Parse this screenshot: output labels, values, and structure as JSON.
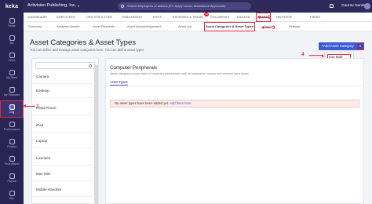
{
  "brand": "keka",
  "topbar": {
    "company": "Activision Publishing, Inc.",
    "search_placeholder": "Search employees or actions (Ex: Apply Leave, Attendance Approvals)",
    "user": "Gaurav Nandan"
  },
  "rail": [
    {
      "label": "Home"
    },
    {
      "label": "Me"
    },
    {
      "label": "Inbox"
    },
    {
      "label": "My Team"
    },
    {
      "label": "My Finances"
    },
    {
      "label": "Org"
    },
    {
      "label": "Performance"
    },
    {
      "label": "Project"
    },
    {
      "label": "Time Attend"
    },
    {
      "label": "Payroll"
    },
    {
      "label": "Hire"
    }
  ],
  "module_tabs": [
    "DASHBOARD",
    "EMPLOYEES",
    "ORG STRUCTURE",
    "ONBOARDING",
    "EXITS",
    "EXPENSES & TRAVEL",
    "DOCUMENTS",
    "ENGAGE",
    "ASSETS",
    "HELPDESK",
    "HIRING"
  ],
  "module_badge": "10",
  "sub_tabs": [
    "Summary",
    "Assigned Assets",
    "Asset Requests",
    "Asset Acknowledgement",
    "Asset List",
    "Asset Categories & Asset Types",
    "Reports",
    "Settings"
  ],
  "page": {
    "title": "Asset Categories & Asset Types",
    "description": "You can define and manage asset categories here. You can define asset types"
  },
  "add_button": "+Add Asset Category",
  "bulk_menu_item": "Use Bulk Import",
  "categories": [
    "Camera",
    "Desktop",
    "Head Phone",
    "iPad",
    "Laptop",
    "Licenses",
    "Mac Mini",
    "Mobile Handset"
  ],
  "active_category": "Computer Peripherals",
  "detail": {
    "title": "Computer Peripherals",
    "description": "Asset category to keep track of computer peripherals such as keyboards, mouse and external hard drives",
    "tab": "Asset Types",
    "notice": "No asset types have been added yet.",
    "notice_link": "Add them here"
  },
  "annotations": [
    "1",
    "2",
    "3",
    "4"
  ],
  "colors": {
    "rail": "#2a2452",
    "accent": "#3b5bdb",
    "annotation": "#e0283c"
  }
}
